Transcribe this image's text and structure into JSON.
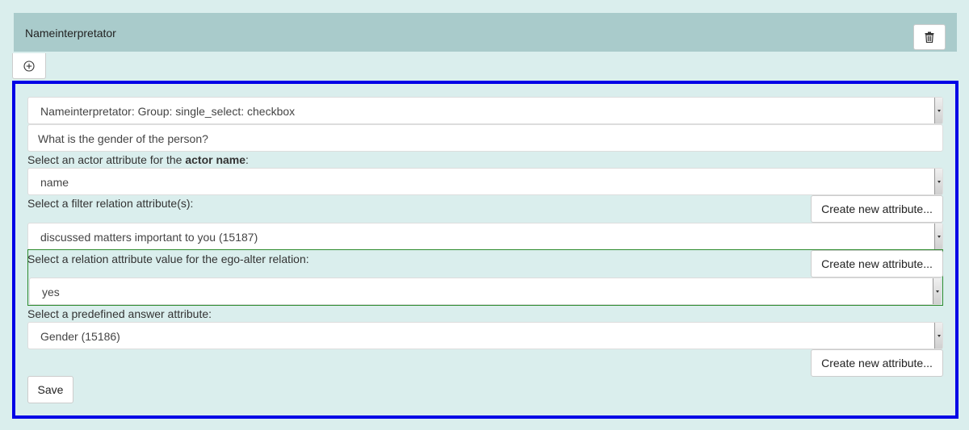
{
  "header": {
    "title": "Nameinterpretator"
  },
  "icons": {
    "trash": "trash-icon",
    "add": "plus-circle-icon"
  },
  "form": {
    "question_type_select": {
      "value": "Nameinterpretator: Group: single_select: checkbox"
    },
    "question_input": {
      "value": "What is the gender of the person?"
    },
    "actor_attr_label_prefix": "Select an actor attribute for the ",
    "actor_attr_label_bold": "actor name",
    "actor_attr_label_suffix": ":",
    "actor_attr_select": {
      "value": "name"
    },
    "filter_label": "Select a filter relation attribute(s):",
    "filter_create_label": "Create new attribute...",
    "filter_select": {
      "value": "discussed matters important to you (15187)"
    },
    "ego_label": "Select a relation attribute value for the ego-alter relation:",
    "ego_create_label": "Create new attribute...",
    "ego_select": {
      "value": "yes"
    },
    "predef_label": "Select a predefined answer attribute:",
    "predef_select": {
      "value": "Gender (15186)"
    },
    "predef_create_label": "Create new attribute...",
    "save_label": "Save"
  },
  "colors": {
    "panel_border": "#0000e6",
    "header_bg": "#a9cbcb",
    "page_bg": "#daeeed",
    "ego_border": "#2e8b2e"
  }
}
